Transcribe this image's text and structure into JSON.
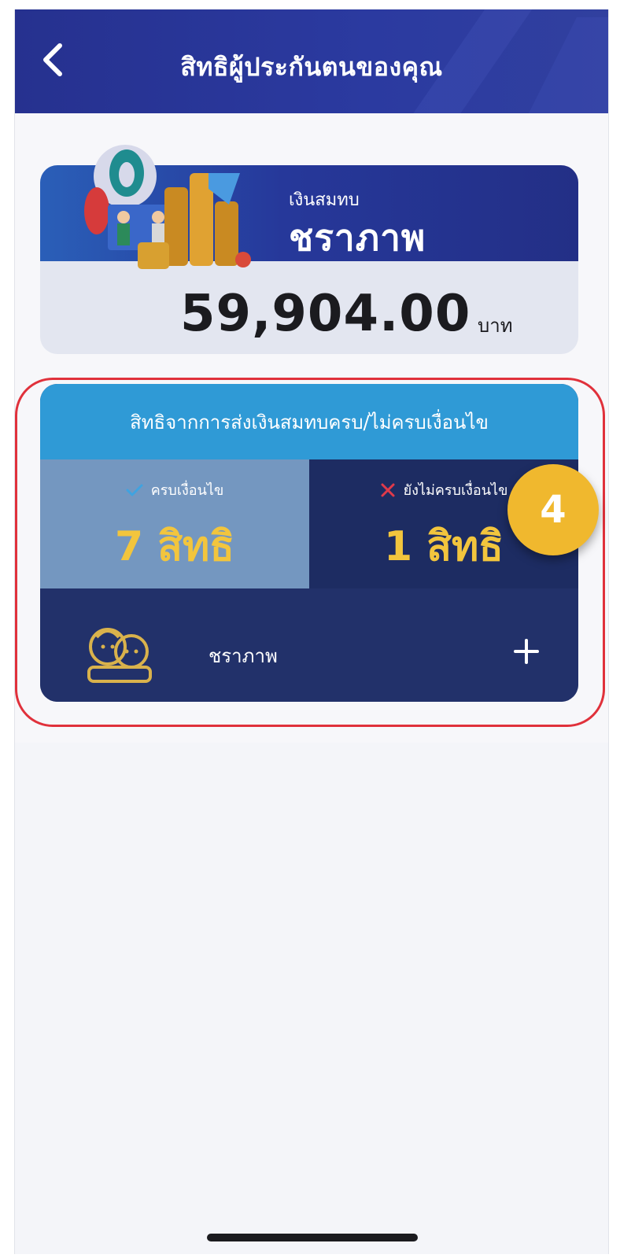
{
  "header": {
    "title": "สิทธิผู้ประกันตนของคุณ",
    "back_icon": "chevron-left-icon"
  },
  "balance_card": {
    "fund_label": "เงินสมทบ",
    "fund_name": "ชราภาพ",
    "amount": "59,904.00",
    "currency": "บาท"
  },
  "rights_card": {
    "heading": "สิทธิจากการส่งเงินสมทบครบ/ไม่ครบเงื่อนไข",
    "met": {
      "label": "ครบเงื่อนไข",
      "count": "7 สิทธิ",
      "icon": "check-icon"
    },
    "unmet": {
      "label": "ยังไม่ครบเงื่อนไข",
      "count": "1 สิทธิ",
      "icon": "x-icon"
    },
    "item": {
      "label": "ชราภาพ",
      "icon": "elderly-couple-icon",
      "action_icon": "plus-icon"
    }
  },
  "annotation": {
    "step": "4"
  },
  "colors": {
    "header": "#2b3aa0",
    "accent_yellow": "#f2c53d",
    "rights_head": "#2f9ad6",
    "highlight": "#e0313b"
  }
}
